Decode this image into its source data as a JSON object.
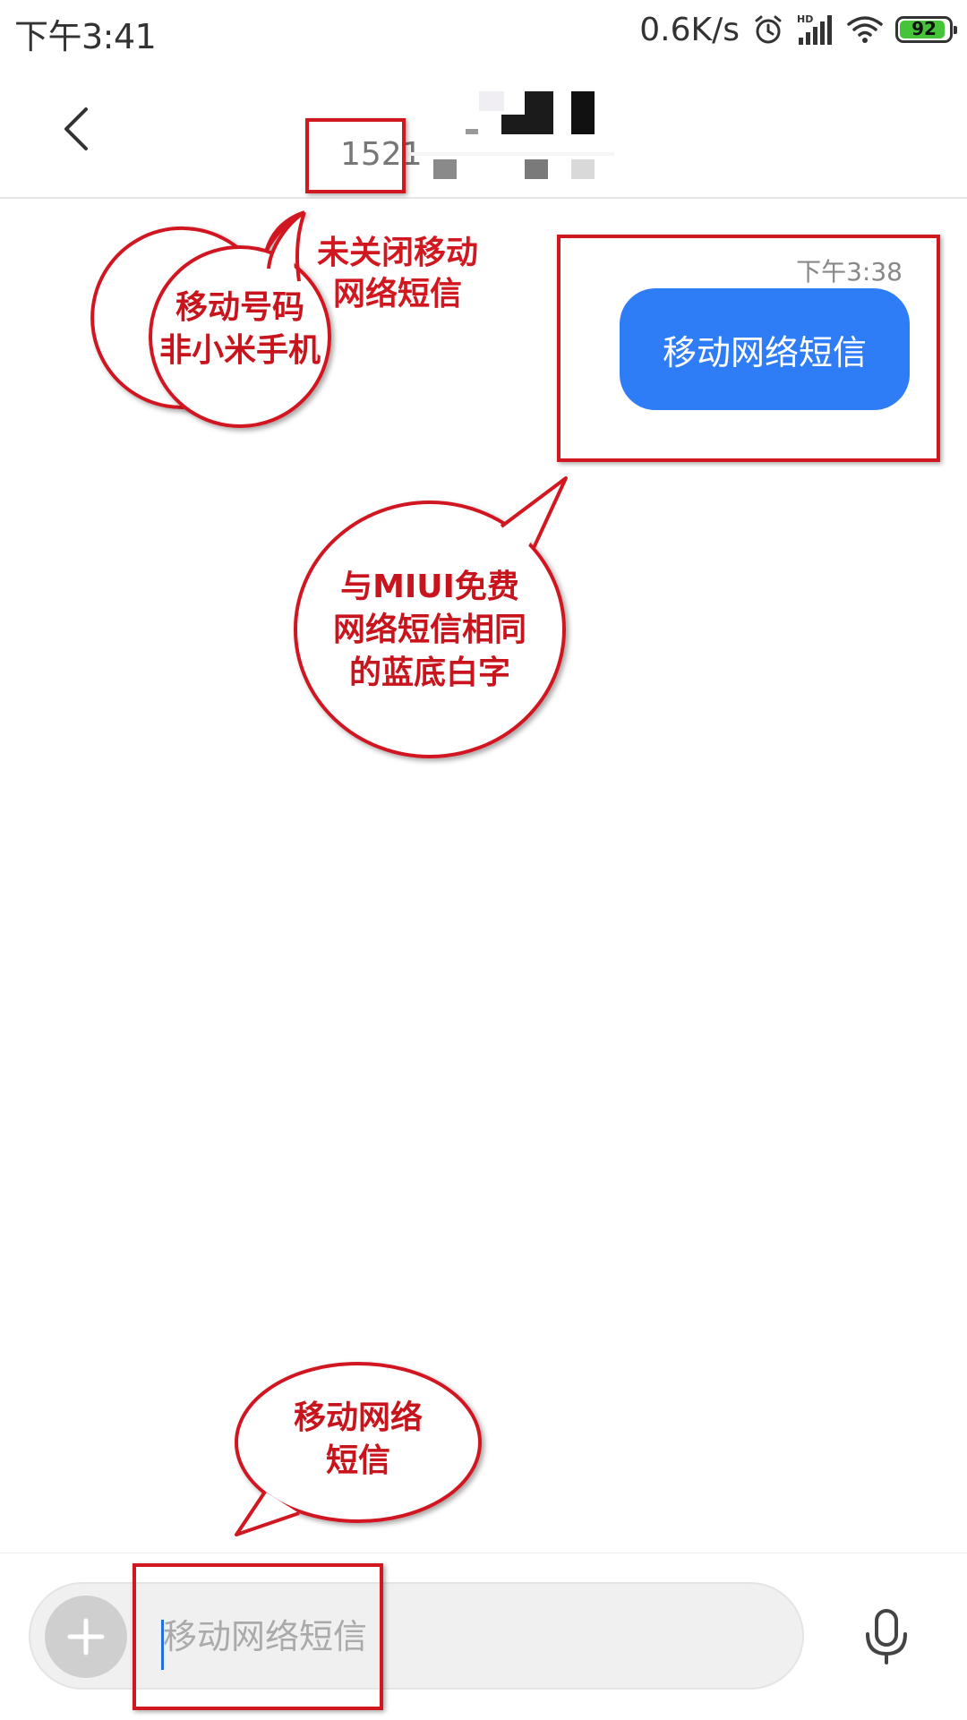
{
  "status_bar": {
    "time": "下午3:41",
    "net_speed": "0.6K/s",
    "battery_level": 92,
    "battery_label": "92",
    "battery_color": "#45c43a",
    "icons": [
      "alarm-icon",
      "hd-signal-icon",
      "wifi-icon",
      "battery-icon"
    ]
  },
  "header": {
    "contact_number": "1521"
  },
  "message": {
    "time": "下午3:38",
    "text": "移动网络短信",
    "bubble_color": "#2f7df6"
  },
  "input": {
    "value": "移动网络短信"
  },
  "annotations": {
    "labels": {
      "not_closed": [
        "未关闭移动",
        "网络短信"
      ]
    },
    "bubbles": {
      "mobile_number": [
        "移动号码",
        "非小米手机"
      ],
      "same_as_miui": [
        "与MIUI免费",
        "网络短信相同",
        "的蓝底白字"
      ],
      "mobile_sms": [
        "移动网络",
        "短信"
      ]
    },
    "color": "#d11820"
  }
}
